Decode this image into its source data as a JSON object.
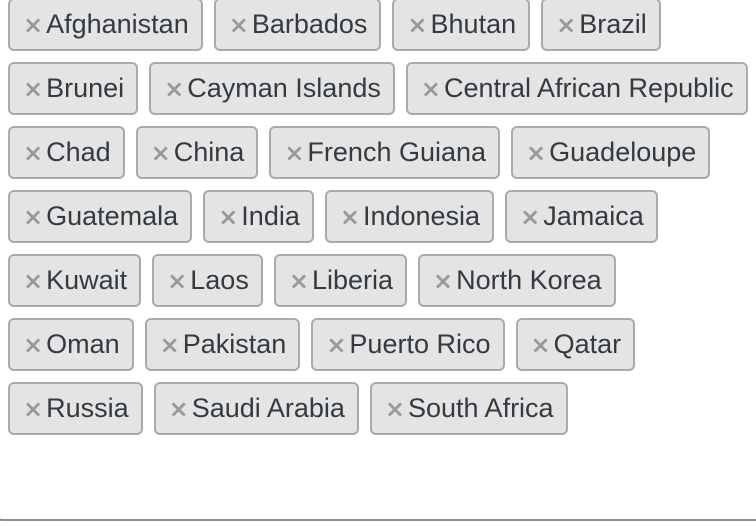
{
  "selected_tags": [
    "Afghanistan",
    "Barbados",
    "Bhutan",
    "Brazil",
    "Brunei",
    "Cayman Islands",
    "Central African Republic",
    "Chad",
    "China",
    "French Guiana",
    "Guadeloupe",
    "Guatemala",
    "India",
    "Indonesia",
    "Jamaica",
    "Kuwait",
    "Laos",
    "Liberia",
    "North Korea",
    "Oman",
    "Pakistan",
    "Puerto Rico",
    "Qatar",
    "Russia",
    "Saudi Arabia",
    "South Africa"
  ],
  "remove_icon": "×"
}
